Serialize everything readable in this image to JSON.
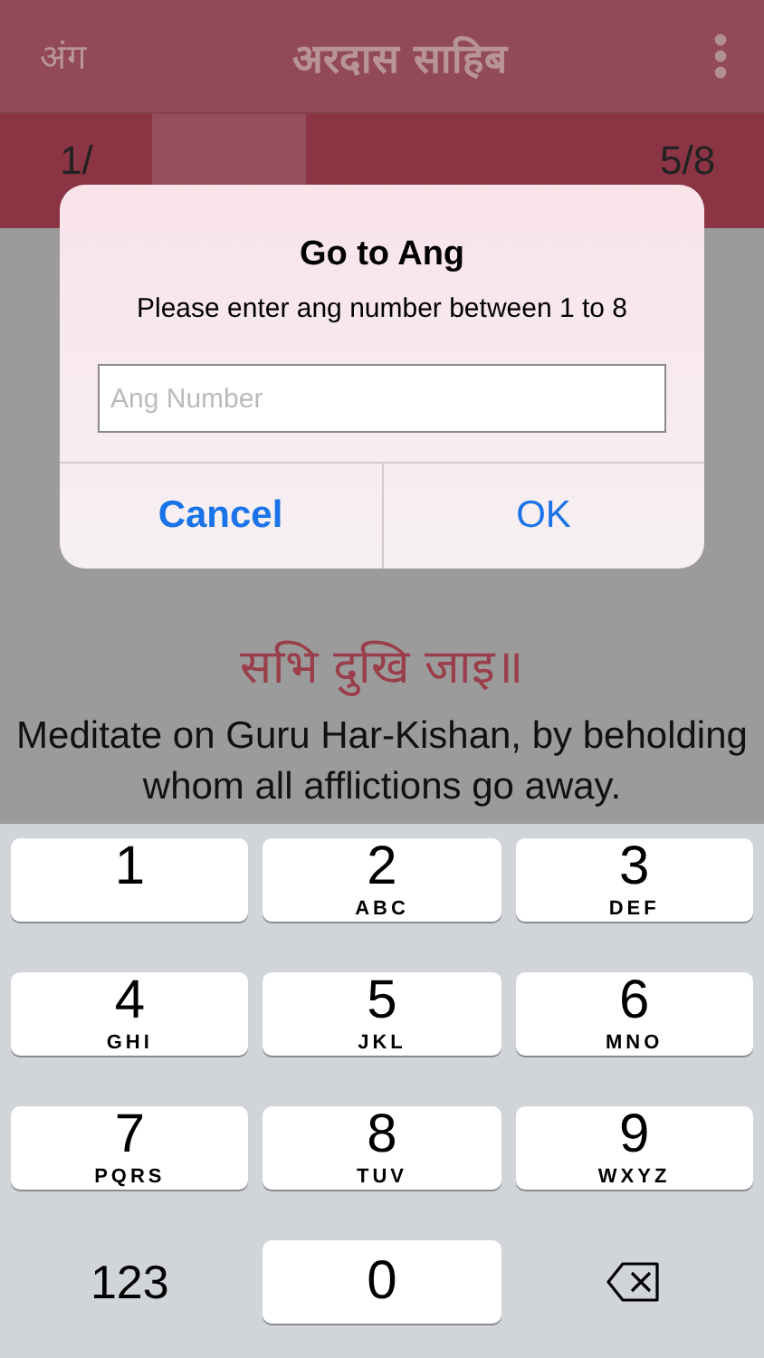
{
  "header": {
    "left": "अंग",
    "title": "अरदास साहिब"
  },
  "tabs": [
    {
      "label": "1/",
      "selected": false
    },
    {
      "selected": true
    },
    {
      "selected": false
    },
    {
      "selected": false
    },
    {
      "label": "5/8",
      "selected": false
    }
  ],
  "content": {
    "verse": "सभि दुखि जाइ॥",
    "translation": "Meditate on Guru Har-Kishan, by beholding whom all afflictions go away."
  },
  "dialog": {
    "title": "Go to Ang",
    "message": "Please enter ang number between 1 to 8",
    "placeholder": "Ang Number",
    "buttons": [
      {
        "label": "Cancel",
        "kind": "cancel"
      },
      {
        "label": "OK",
        "kind": "default"
      }
    ]
  },
  "keyboard": [
    {
      "digit": "1",
      "kind": "digit"
    },
    {
      "digit": "2",
      "letters": "ABC",
      "kind": "digit"
    },
    {
      "digit": "3",
      "letters": "DEF",
      "kind": "digit"
    },
    {
      "digit": "4",
      "letters": "GHI",
      "kind": "digit"
    },
    {
      "digit": "5",
      "letters": "JKL",
      "kind": "digit"
    },
    {
      "digit": "6",
      "letters": "MNO",
      "kind": "digit"
    },
    {
      "digit": "7",
      "letters": "PQRS",
      "kind": "digit"
    },
    {
      "digit": "8",
      "letters": "TUV",
      "kind": "digit"
    },
    {
      "digit": "9",
      "letters": "WXYZ",
      "kind": "digit"
    },
    {
      "digit": "123",
      "kind": "mode"
    },
    {
      "digit": "0",
      "kind": "digit"
    },
    {
      "kind": "delete"
    }
  ]
}
